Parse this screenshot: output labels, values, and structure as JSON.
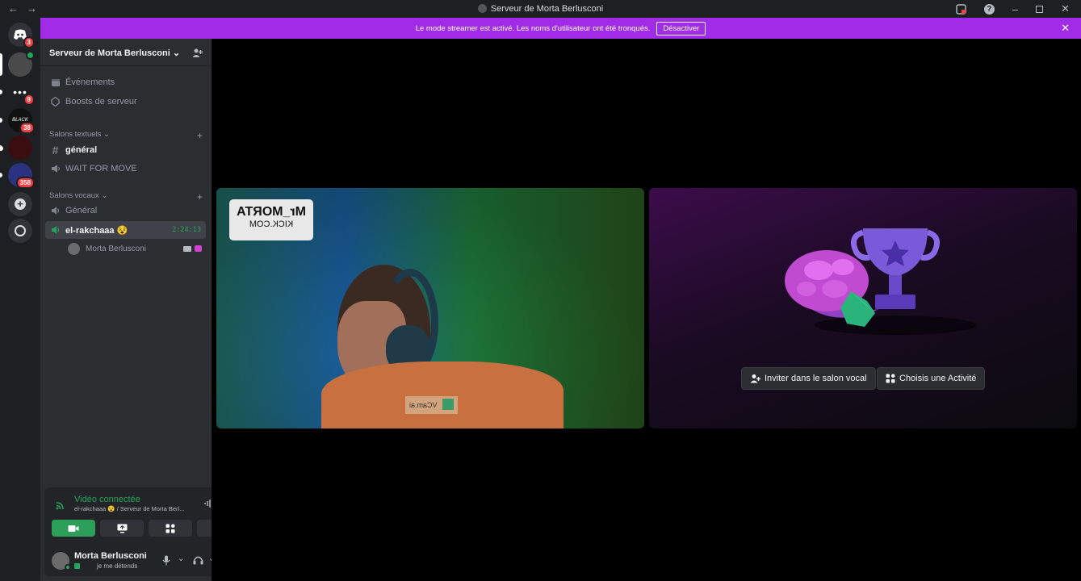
{
  "window": {
    "title": "Serveur de Morta Berlusconi",
    "back": "←",
    "forward": "→"
  },
  "guilds": [
    {
      "name": "home",
      "badge": "3"
    },
    {
      "name": "server-1",
      "badge": ""
    },
    {
      "name": "server-2",
      "badge": "9"
    },
    {
      "name": "server-3",
      "badge": "38"
    },
    {
      "name": "server-4",
      "badge": ""
    },
    {
      "name": "server-5",
      "badge": "358"
    }
  ],
  "banner": {
    "text": "Le mode streamer est activé. Les noms d'utilisateur ont été tronqués.",
    "button": "Désactiver"
  },
  "sidebar": {
    "server_name": "Serveur de Morta Berlusconi",
    "events": "Événements",
    "boosts": "Boosts de serveur",
    "text_category": "Salons textuels",
    "text_channels": [
      "général",
      "WAIT FOR MOVE"
    ],
    "voice_category": "Salons vocaux",
    "voice_channels": [
      "Général",
      "el-rakchaaa 😵"
    ],
    "voice_timer": "2:24:13",
    "voice_member": "Morta Berlusconi"
  },
  "voice_panel": {
    "title": "Vidéo connectée",
    "subtitle": "el-rakchaaa 😵 / Serveur de Morta Berl..."
  },
  "user": {
    "name": "Morta Berlusconi",
    "status": "je me détends"
  },
  "stage": {
    "cam_watermark_line1": "Mr_MORTA",
    "cam_watermark_line2": "KICK.COM",
    "shirt_text": "VCam.ai",
    "invite_button": "Inviter dans le salon vocal",
    "activity_button": "Choisis une Activité"
  },
  "colors": {
    "accent": "#a12ce8",
    "green": "#23a55a",
    "badge": "#f23f43"
  }
}
